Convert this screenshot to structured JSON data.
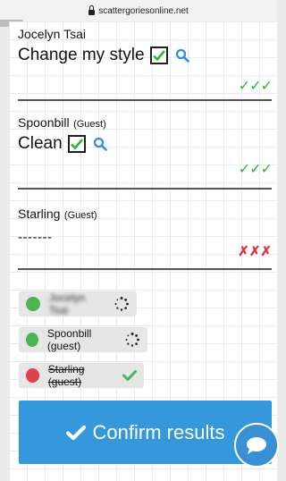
{
  "browser": {
    "url": "scattergoriesonline.net"
  },
  "entries": [
    {
      "player": "Jocelyn Tsai",
      "guest": "",
      "answer": "Change my style",
      "checked": true,
      "votes": "✓✓✓"
    },
    {
      "player": "Spoonbill",
      "guest": "(Guest)",
      "answer": "Clean",
      "checked": true,
      "votes": "✓✓✓"
    },
    {
      "player": "Starling",
      "guest": "(Guest)",
      "answer": "-------",
      "checked": false,
      "votes": "✗✗✗"
    }
  ],
  "players": [
    {
      "name": "Jocelyn Tsai",
      "status": "green",
      "state": "pending"
    },
    {
      "name": "Spoonbill (guest)",
      "status": "green",
      "state": "pending"
    },
    {
      "name": "Starling (guest)",
      "status": "red",
      "state": "confirmed"
    }
  ],
  "confirm_label": "Confirm results",
  "colors": {
    "accent": "#3498db",
    "vote_ok": "#2fb33a",
    "vote_bad": "#e0343c"
  }
}
